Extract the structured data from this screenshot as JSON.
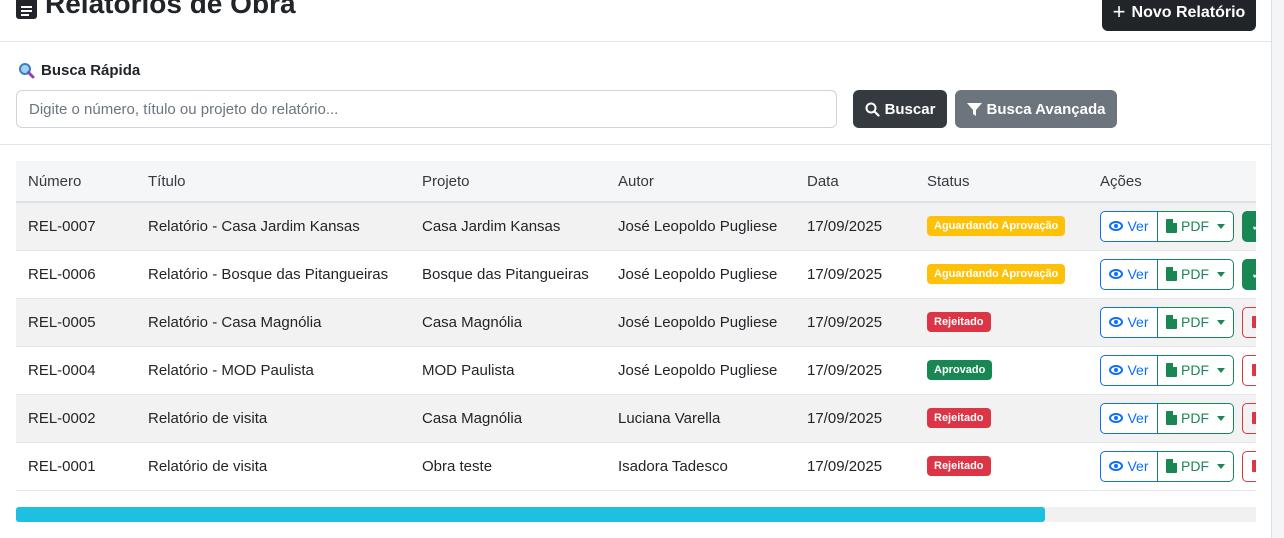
{
  "page": {
    "title": "Relatórios de Obra",
    "new_button": "Novo Relatório"
  },
  "search": {
    "label": "Busca Rápida",
    "placeholder": "Digite o número, título ou projeto do relatório...",
    "value": "",
    "search_button": "Buscar",
    "advanced_button": "Busca Avançada"
  },
  "table": {
    "headers": [
      "Número",
      "Título",
      "Projeto",
      "Autor",
      "Data",
      "Status",
      "Ações"
    ],
    "action_labels": {
      "view": "Ver",
      "pdf": "PDF"
    },
    "rows": [
      {
        "numero": "REL-0007",
        "titulo": "Relatório - Casa Jardim Kansas",
        "projeto": "Casa Jardim Kansas",
        "autor": "José Leopoldo Pugliese",
        "data": "17/09/2025",
        "status": "Aguardando Aprovação",
        "status_type": "warning",
        "extra_action": "approve"
      },
      {
        "numero": "REL-0006",
        "titulo": "Relatório - Bosque das Pitangueiras",
        "projeto": "Bosque das Pitangueiras",
        "autor": "José Leopoldo Pugliese",
        "data": "17/09/2025",
        "status": "Aguardando Aprovação",
        "status_type": "warning",
        "extra_action": "approve"
      },
      {
        "numero": "REL-0005",
        "titulo": "Relatório - Casa Magnólia",
        "projeto": "Casa Magnólia",
        "autor": "José Leopoldo Pugliese",
        "data": "17/09/2025",
        "status": "Rejeitado",
        "status_type": "danger",
        "extra_action": "delete"
      },
      {
        "numero": "REL-0004",
        "titulo": "Relatório - MOD Paulista",
        "projeto": "MOD Paulista",
        "autor": "José Leopoldo Pugliese",
        "data": "17/09/2025",
        "status": "Aprovado",
        "status_type": "success",
        "extra_action": "delete"
      },
      {
        "numero": "REL-0002",
        "titulo": "Relatório de visita",
        "projeto": "Casa Magnólia",
        "autor": "Luciana Varella",
        "data": "17/09/2025",
        "status": "Rejeitado",
        "status_type": "danger",
        "extra_action": "delete"
      },
      {
        "numero": "REL-0001",
        "titulo": "Relatório de visita",
        "projeto": "Obra teste",
        "autor": "Isadora Tadesco",
        "data": "17/09/2025",
        "status": "Rejeitado",
        "status_type": "danger",
        "extra_action": "delete"
      }
    ]
  },
  "colors": {
    "warning": "#ffc107",
    "danger": "#dc3545",
    "success": "#198754",
    "primary": "#0d6efd",
    "scroll_thumb": "#1ec0e2"
  },
  "scroll": {
    "horizontal_fraction": 0.83
  }
}
